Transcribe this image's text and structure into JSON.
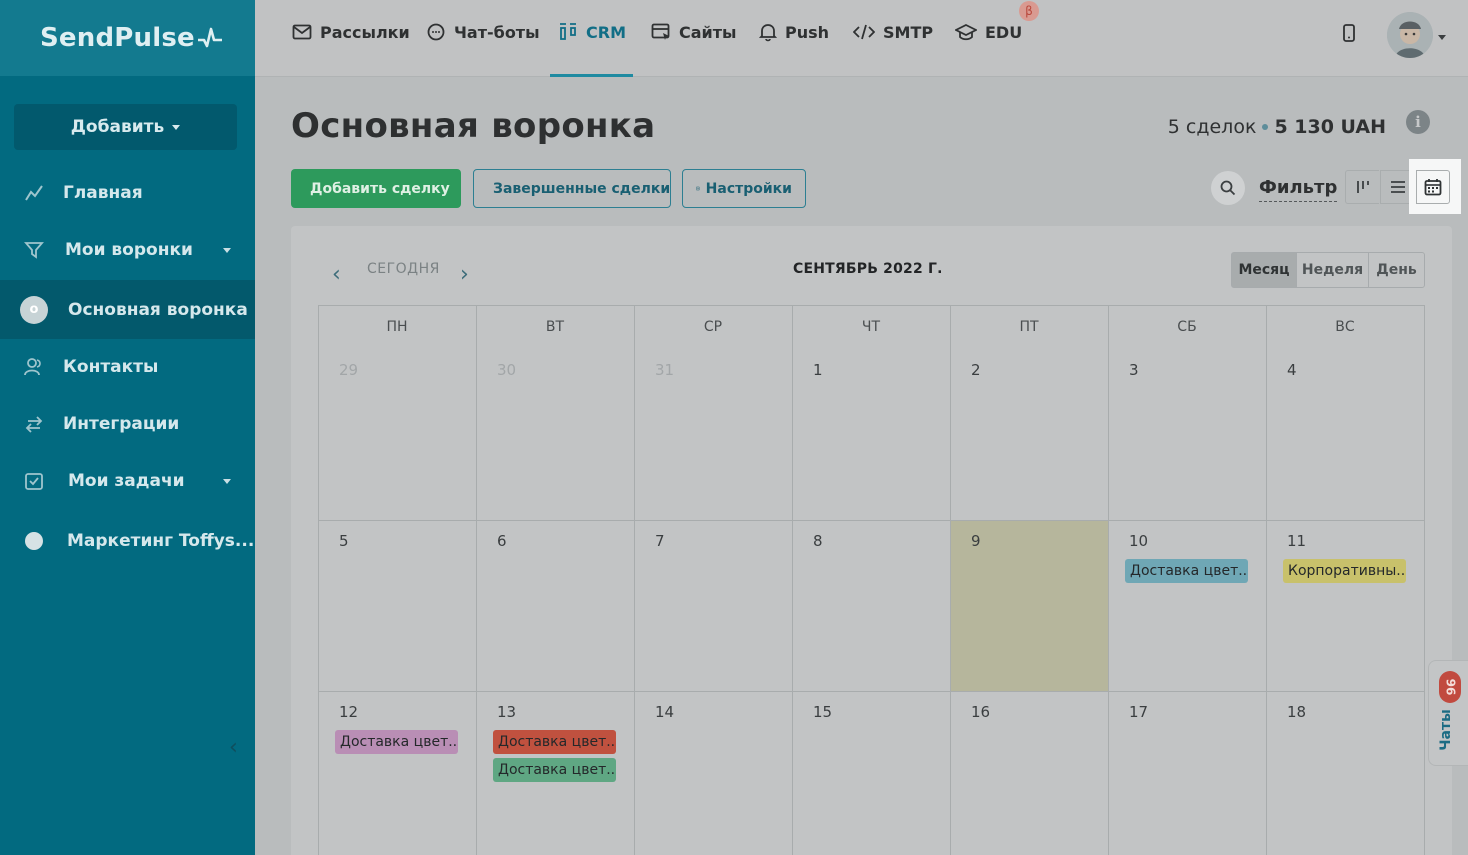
{
  "sidebar": {
    "logo": "SendPulse",
    "add_button": "Добавить",
    "items": [
      {
        "label": "Главная"
      },
      {
        "label": "Мои воронки"
      },
      {
        "label": "Основная воронка"
      },
      {
        "label": "Контакты"
      },
      {
        "label": "Интеграции"
      },
      {
        "label": "Мои задачи"
      },
      {
        "label": "Маркетинг Toffys..."
      }
    ]
  },
  "topnav": {
    "items": [
      {
        "label": "Рассылки",
        "icon": "mail-icon"
      },
      {
        "label": "Чат-боты",
        "icon": "chat-icon"
      },
      {
        "label": "CRM",
        "icon": "crm-icon"
      },
      {
        "label": "Сайты",
        "icon": "site-icon"
      },
      {
        "label": "Push",
        "icon": "bell-icon"
      },
      {
        "label": "SMTP",
        "icon": "code-icon"
      },
      {
        "label": "EDU",
        "icon": "graduation-icon"
      }
    ],
    "beta_badge": "β",
    "active": "CRM"
  },
  "page": {
    "title": "Основная воронка",
    "deals_count": "5 сделок",
    "deals_sum": "5 130 UAH",
    "add_deal": "Добавить сделку",
    "finished_deals": "Завершенные сделки",
    "settings": "Настройки",
    "filter": "Фильтр"
  },
  "calendar": {
    "today_label": "СЕГОДНЯ",
    "month_label": "СЕНТЯБРЬ 2022 Г.",
    "views": [
      "Месяц",
      "Неделя",
      "День"
    ],
    "active_view": "Месяц",
    "weekdays": [
      "ПН",
      "ВТ",
      "СР",
      "ЧТ",
      "ПТ",
      "СБ",
      "ВС"
    ],
    "weeks": [
      [
        "29",
        "30",
        "31",
        "1",
        "2",
        "3",
        "4"
      ],
      [
        "5",
        "6",
        "7",
        "8",
        "9",
        "10",
        "11"
      ],
      [
        "12",
        "13",
        "14",
        "15",
        "16",
        "17",
        "18"
      ]
    ],
    "today": "9",
    "events": [
      {
        "day": "10",
        "label": "Доставка цвет...",
        "color": "#6fa7b5"
      },
      {
        "day": "11",
        "label": "Корпоративны...",
        "color": "#c8c16b"
      },
      {
        "day": "12",
        "label": "Доставка цвет...",
        "color": "#b98eb5"
      },
      {
        "day": "13",
        "label": "Доставка цвет...",
        "color": "#c0513f"
      },
      {
        "day": "13",
        "label": "Доставка цвет...",
        "color": "#5fa783"
      }
    ]
  },
  "chats": {
    "label": "Чаты",
    "count": "96"
  },
  "colors": {
    "sidebar": "#026a80",
    "accent": "#126e86",
    "primary_button": "#2d9a5c"
  }
}
